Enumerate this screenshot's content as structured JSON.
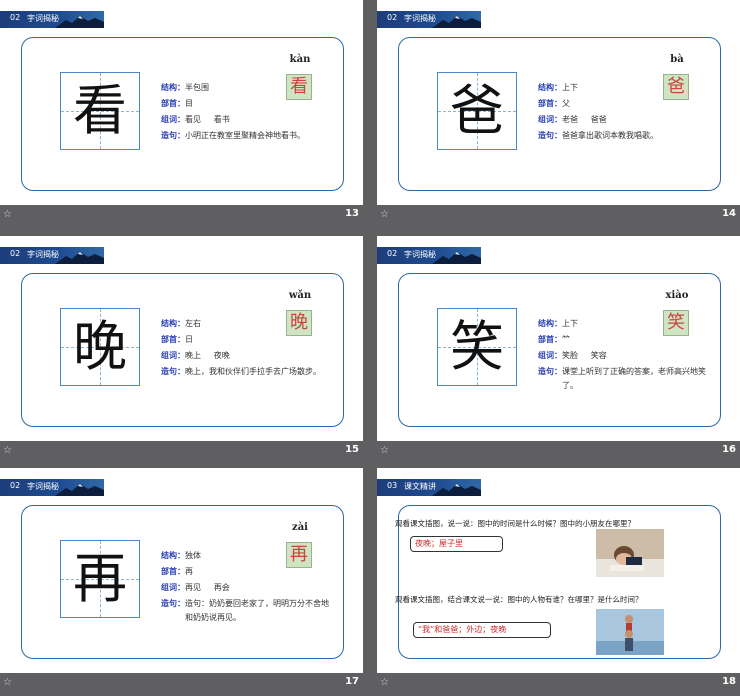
{
  "slides": [
    {
      "section_num": "02",
      "section_title": "字词揭秘",
      "char": "看",
      "pinyin": "kàn",
      "labels": {
        "structure": "结构：",
        "radical": "部首：",
        "words": "组词：",
        "sentence": "造句："
      },
      "structure": "半包围",
      "radical": "目",
      "words": "看见     看书",
      "sentence": "小明正在教室里聚精会神地看书。",
      "page": "13",
      "star": "☆"
    },
    {
      "section_num": "02",
      "section_title": "字词揭秘",
      "char": "爸",
      "pinyin": "bà",
      "labels": {
        "structure": "结构：",
        "radical": "部首：",
        "words": "组词：",
        "sentence": "造句："
      },
      "structure": "上下",
      "radical": "父",
      "words": "老爸     爸爸",
      "sentence": "爸爸拿出歌词本教我唱歌。",
      "page": "14",
      "star": "☆"
    },
    {
      "section_num": "02",
      "section_title": "字词揭秘",
      "char": "晚",
      "pinyin": "wǎn",
      "labels": {
        "structure": "结构：",
        "radical": "部首：",
        "words": "组词：",
        "sentence": "造句："
      },
      "structure": "左右",
      "radical": "日",
      "words": "晚上     夜晚",
      "sentence": "晚上，我和伙伴们手拉手去广场散步。",
      "page": "15",
      "star": "☆"
    },
    {
      "section_num": "02",
      "section_title": "字词揭秘",
      "char": "笑",
      "pinyin": "xiào",
      "labels": {
        "structure": "结构：",
        "radical": "部首：",
        "words": "组词：",
        "sentence": "造句："
      },
      "structure": "上下",
      "radical": "⺮",
      "words": "笑脸     笑容",
      "sentence": "课堂上听到了正确的答案，老师高兴地笑了。",
      "page": "16",
      "star": "☆"
    },
    {
      "section_num": "02",
      "section_title": "字词揭秘",
      "char": "再",
      "pinyin": "zài",
      "labels": {
        "structure": "结构：",
        "radical": "部首：",
        "words": "组词：",
        "sentence": "造句："
      },
      "structure": "独体",
      "radical": "再",
      "words": "再见     再会",
      "sentence": "造句：奶奶要回老家了，明明万分不舍地和奶奶说再见。",
      "page": "17",
      "star": "☆"
    }
  ],
  "slide18": {
    "section_num": "03",
    "section_title": "课文精讲",
    "q1": "观看课文插图，说一说：图中的时间是什么时候？图中的小朋友在哪里？",
    "a1": "夜晚；屋子里",
    "q2": "观看课文插图，结合课文说一说：图中的人物有谁？在哪里？是什么时间？",
    "a2": "“我”和爸爸；外边；夜晚",
    "page": "18",
    "star": "☆"
  }
}
